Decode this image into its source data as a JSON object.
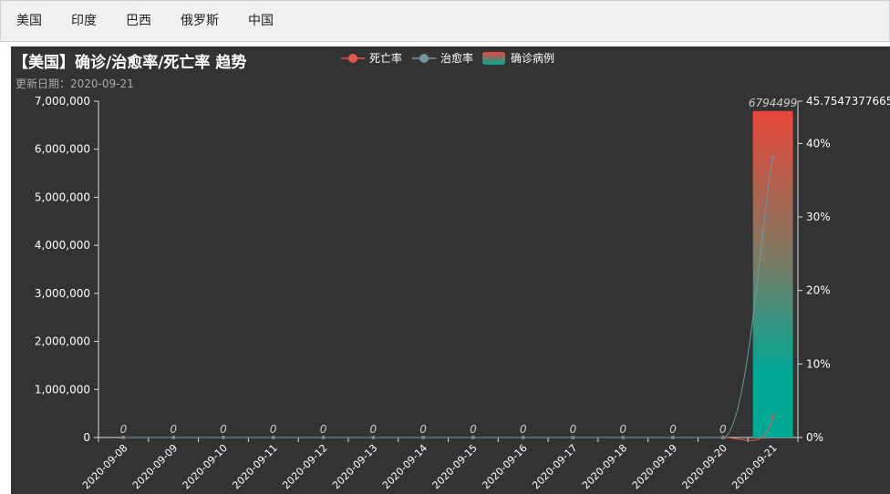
{
  "tabs": [
    "美国",
    "印度",
    "巴西",
    "俄罗斯",
    "中国"
  ],
  "chart": {
    "title": "【美国】确诊/治愈率/死亡率 趋势",
    "subtitle": "更新日期：2020-09-21"
  },
  "legend": [
    {
      "name": "死亡率",
      "color": "#e5574d"
    },
    {
      "name": "治愈率",
      "color": "#6f9aa5"
    },
    {
      "name": "确诊病例",
      "color_top": "#e8473a",
      "color_bottom": "#00a896"
    }
  ],
  "chart_data": {
    "type": "bar",
    "title": "【美国】确诊/治愈率/死亡率 趋势",
    "subtitle": "更新日期：2020-09-21",
    "categories": [
      "2020-09-08",
      "2020-09-09",
      "2020-09-10",
      "2020-09-11",
      "2020-09-12",
      "2020-09-13",
      "2020-09-14",
      "2020-09-15",
      "2020-09-16",
      "2020-09-17",
      "2020-09-18",
      "2020-09-19",
      "2020-09-20",
      "2020-09-21"
    ],
    "bar_labels": [
      "0",
      "0",
      "0",
      "0",
      "0",
      "0",
      "0",
      "0",
      "0",
      "0",
      "0",
      "0",
      "0",
      "6794499"
    ],
    "series": [
      {
        "name": "确诊病例",
        "type": "bar",
        "axis": "left",
        "values": [
          0,
          0,
          0,
          0,
          0,
          0,
          0,
          0,
          0,
          0,
          0,
          0,
          0,
          6794499
        ]
      },
      {
        "name": "死亡率",
        "type": "line",
        "axis": "right",
        "values": [
          0,
          0,
          0,
          0,
          0,
          0,
          0,
          0,
          0,
          0,
          0,
          0,
          0,
          2.95
        ]
      },
      {
        "name": "治愈率",
        "type": "line",
        "axis": "right",
        "values": [
          0,
          0,
          0,
          0,
          0,
          0,
          0,
          0,
          0,
          0,
          0,
          0,
          0,
          38.1
        ]
      }
    ],
    "y_left": {
      "min": 0,
      "max": 7000000,
      "ticks": [
        "0",
        "1,000,000",
        "2,000,000",
        "3,000,000",
        "4,000,000",
        "5,000,000",
        "6,000,000",
        "7,000,000"
      ]
    },
    "y_right": {
      "min": 0,
      "max": 45.7547377665,
      "ticks": [
        "0%",
        "10%",
        "20%",
        "30%",
        "40%"
      ],
      "max_label": "45.7547377665"
    },
    "legend_position": "top-center",
    "grid": false
  }
}
